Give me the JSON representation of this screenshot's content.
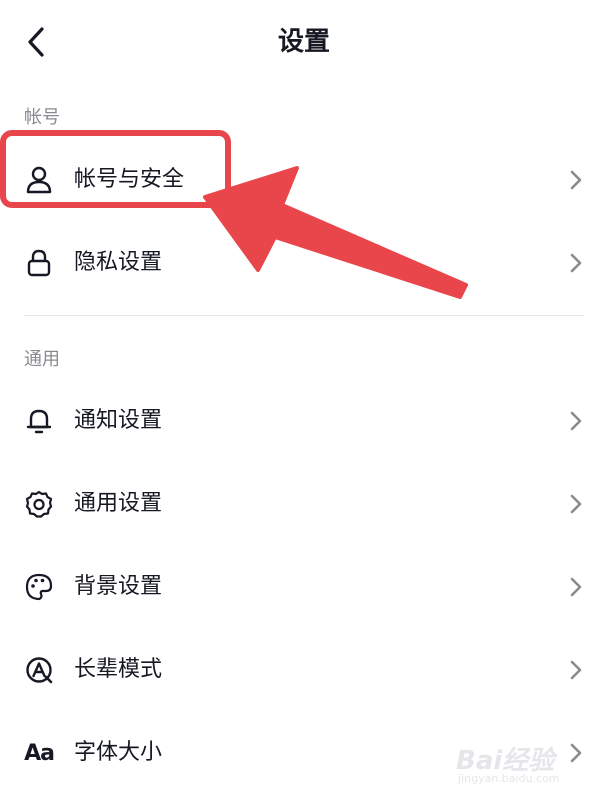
{
  "header": {
    "title": "设置"
  },
  "sections": {
    "account": {
      "title": "帐号",
      "items": [
        {
          "label": "帐号与安全",
          "icon": "user-icon"
        },
        {
          "label": "隐私设置",
          "icon": "lock-icon"
        }
      ]
    },
    "general": {
      "title": "通用",
      "items": [
        {
          "label": "通知设置",
          "icon": "bell-icon"
        },
        {
          "label": "通用设置",
          "icon": "gear-icon"
        },
        {
          "label": "背景设置",
          "icon": "palette-icon"
        },
        {
          "label": "长辈模式",
          "icon": "elder-mode-icon"
        },
        {
          "label": "字体大小",
          "icon": "font-size-icon",
          "icon_text": "Aa"
        }
      ]
    }
  },
  "annotation": {
    "highlight_color": "#e8464b"
  },
  "watermark": {
    "text": "Bai经验",
    "subtext": "jingyan.baidu.com"
  },
  "colors": {
    "text_primary": "#161823",
    "text_secondary": "#8a8b91",
    "chevron": "#8a8b91",
    "divider": "#e8e8ea",
    "annotation": "#e8464b"
  }
}
